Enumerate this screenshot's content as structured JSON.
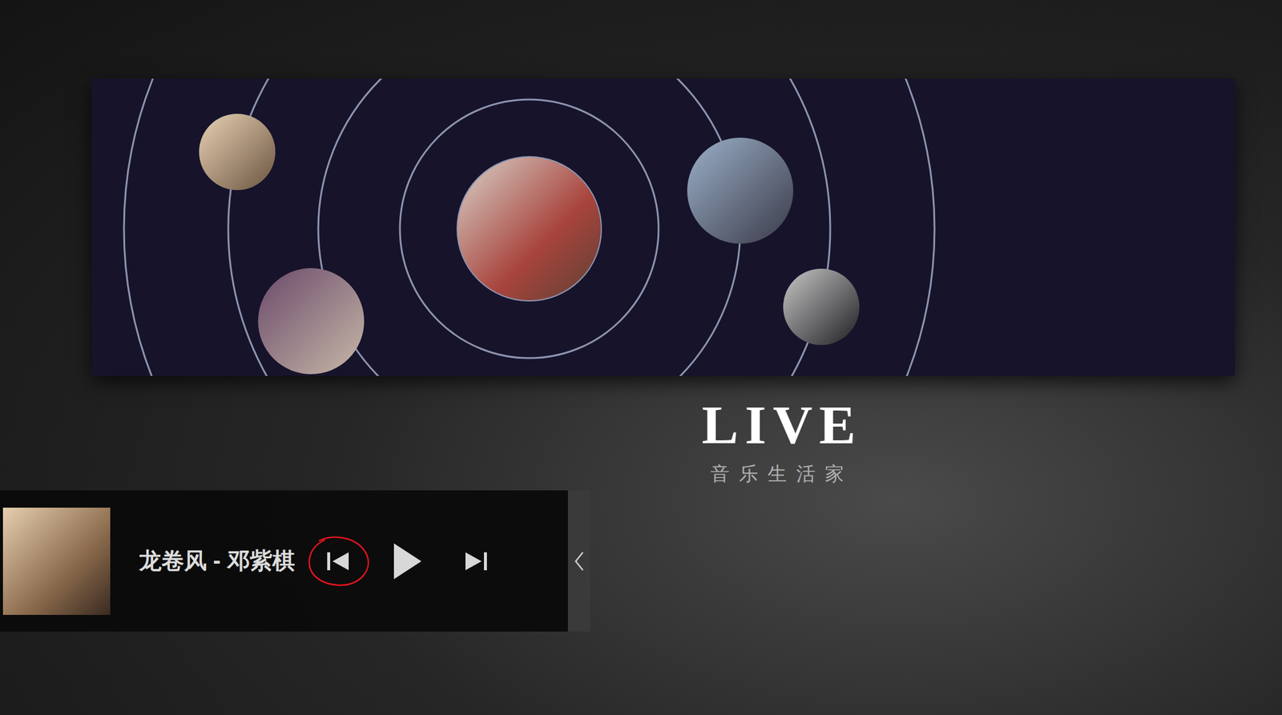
{
  "logo": {
    "title": "LIVE",
    "subtitle": "音乐生活家"
  },
  "player": {
    "track": "龙卷风 - 邓紫棋",
    "playing": false,
    "controls": [
      {
        "kind": "prev",
        "highlighted": true
      },
      {
        "kind": "play",
        "highlighted": false
      },
      {
        "kind": "next",
        "highlighted": false
      }
    ]
  }
}
